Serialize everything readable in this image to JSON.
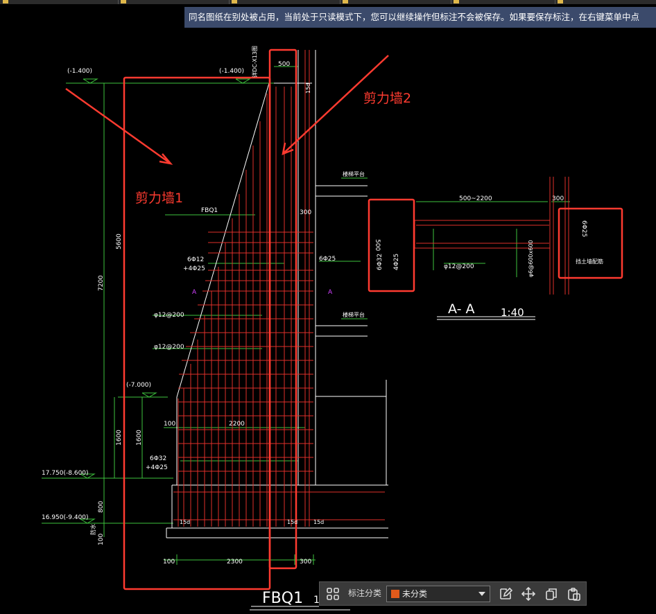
{
  "banner": {
    "text": "同名图纸在别处被占用，当前处于只读模式下，您可以继续操作但标注不会被保存。如果要保存标注，在右键菜单中点"
  },
  "drawing": {
    "annotations": {
      "wall1": "剪力墙1",
      "wall2": "剪力墙2"
    },
    "elevations": {
      "top_left": "(-1.400)",
      "top_mid": "(-1.400)",
      "mid": "(-7.000)",
      "lower1": "17.750(-8.600)",
      "lower2": "16.950(-9.400)"
    },
    "dims": {
      "d500": "500",
      "d7200": "7200",
      "d5600": "5600",
      "d1600a": "1600",
      "d1600b": "1600",
      "d800": "800",
      "d100a": "100",
      "d2200": "2200",
      "d100b": "100",
      "d2300": "2300",
      "d300a": "300",
      "d300b": "300",
      "d15a": "15d",
      "d15b": "15d",
      "d15c": "15d",
      "d15d": "15d",
      "d100v": "100"
    },
    "labels": {
      "fbq": "FBQ1",
      "fbq_suffix": "1",
      "rebar1a": "6Φ12",
      "rebar1b": "+4Φ25",
      "rebar2a": "6Φ32",
      "rebar2b": "+4Φ25",
      "phi12_200a": "φ12@200",
      "phi12_200b": "φ12@200",
      "phi25": "6Φ25",
      "platform1": "楼梯平台",
      "platform2": "楼梯平台",
      "fbq_ref": "FBQ1",
      "marker_a1": "A",
      "marker_a2": "A",
      "top_note": "详DC-X13图",
      "water": "防水"
    },
    "section": {
      "title": "A- A",
      "scale": "1:40",
      "dim_span": "500~2200",
      "dim_300": "300",
      "dim_500": "500",
      "r_6phi32": "6Φ32",
      "r_4phi25": "4Φ25",
      "r_phi12": "φ12@200",
      "r_phi6": "φ6@600x600",
      "r_6phi25": "6Φ25",
      "r_wall": "挡土墙配筋"
    }
  },
  "toolbar": {
    "label": "标注分类",
    "selected": "未分类",
    "accent": "#e15a1b"
  },
  "colors": {
    "background": "#000000",
    "line_white": "#ffffff",
    "line_red": "#e0302a",
    "line_green": "#3ec43e",
    "annotation_red": "#ff3b30",
    "banner_bg": "#3b4a6b"
  }
}
